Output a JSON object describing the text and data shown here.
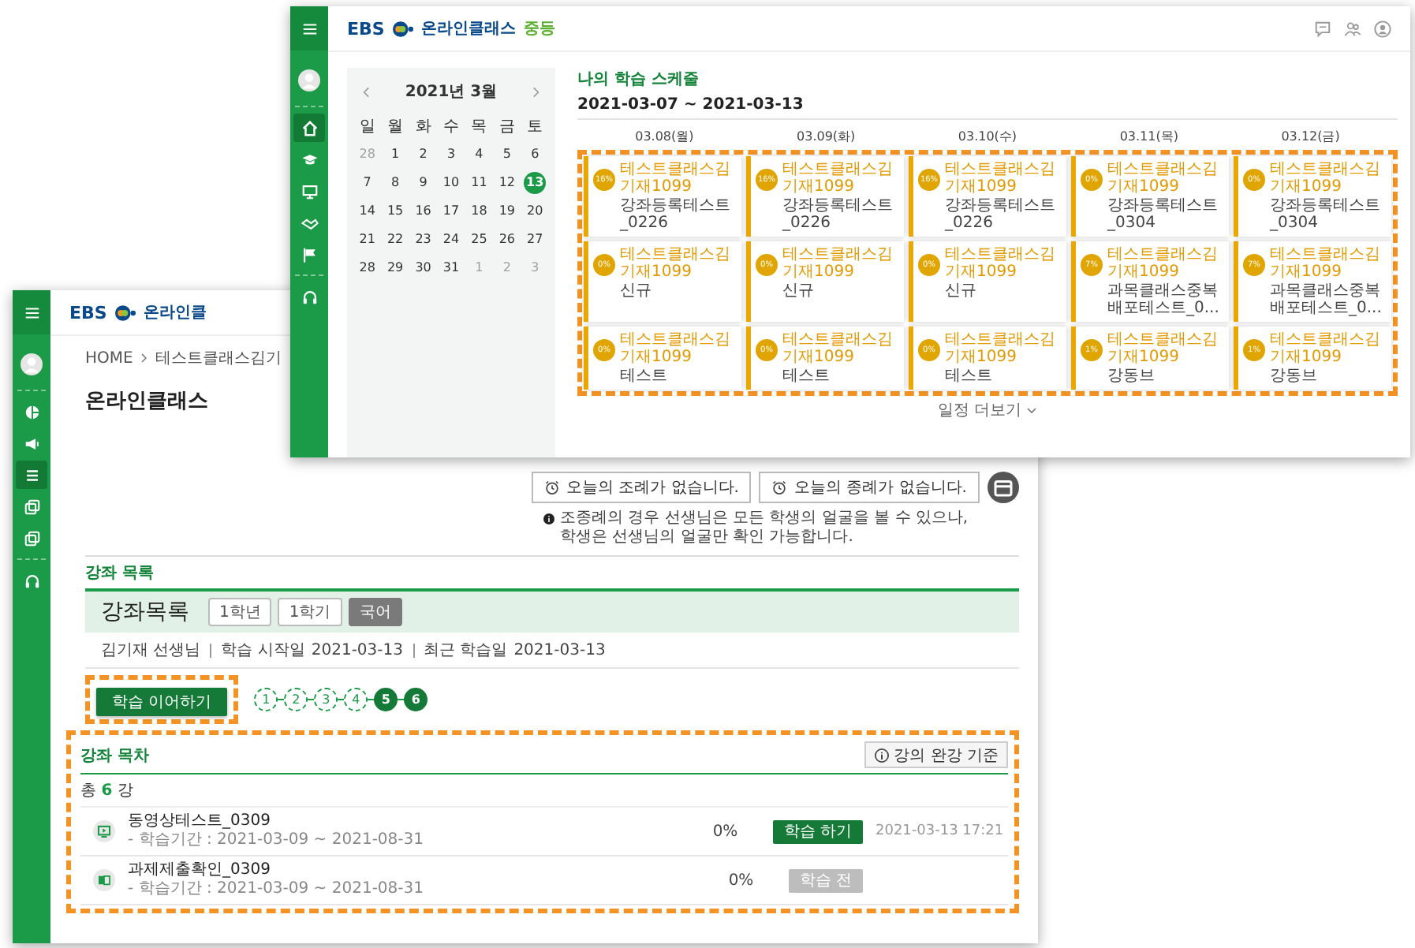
{
  "front": {
    "logo": {
      "brand": "EBS",
      "service": "온라인클"
    },
    "sidebar": [
      {
        "selected": false
      },
      {
        "selected": false
      },
      {
        "selected": true
      },
      {
        "selected": false
      },
      {
        "selected": false
      },
      {
        "selected": false
      }
    ],
    "breadcrumb": [
      "HOME",
      "테스트클래스김기"
    ],
    "page_title": "온라인클래스",
    "notice_buttons": [
      "오늘의 조례가 없습니다.",
      "오늘의 종례가 없습니다."
    ],
    "note": [
      "조종례의 경우 선생님은 모든 학생의 얼굴을 볼 수 있으나,",
      "학생은 선생님의 얼굴만 확인 가능합니다."
    ],
    "section_label": "강좌 목록",
    "course": {
      "title": "강좌목록",
      "chips": [
        {
          "label": "1학년",
          "selected": false
        },
        {
          "label": "1학기",
          "selected": false
        },
        {
          "label": "국어",
          "selected": true
        }
      ],
      "teacher": "김기재 선생님",
      "start_label": "학습 시작일",
      "start_date": "2021-03-13",
      "recent_label": "최근 학습일",
      "recent_date": "2021-03-13"
    },
    "continue_button": "학습 이어하기",
    "continue_highlighted": true,
    "steps": [
      {
        "label": "1",
        "done": false
      },
      {
        "label": "2",
        "done": false
      },
      {
        "label": "3",
        "done": false
      },
      {
        "label": "4",
        "done": false
      },
      {
        "label": "5",
        "done": true
      },
      {
        "label": "6",
        "done": true
      }
    ],
    "lectures": {
      "highlighted": true,
      "title": "강좌 목차",
      "criteria_button": "강의 완강 기준",
      "count": "총 **6** 강",
      "rows": [
        {
          "kind": "video",
          "title": "동영상테스트_0309",
          "period": "- 학습기간 : 2021-03-09 ~ 2021-08-31",
          "progress": "0%",
          "action": "학습 하기",
          "disabled": false,
          "date": "2021-03-13 17:21"
        },
        {
          "kind": "assignment",
          "title": "과제제출확인_0309",
          "period": "- 학습기간 : 2021-03-09 ~ 2021-08-31",
          "progress": "0%",
          "action": "학습 전",
          "disabled": true
        }
      ]
    }
  },
  "back": {
    "logo": {
      "brand": "EBS",
      "service": "온라인클래스",
      "level": "중등"
    },
    "sidebar": [
      {
        "selected": true
      },
      {
        "selected": false
      },
      {
        "selected": false
      },
      {
        "selected": false
      },
      {
        "selected": false
      },
      {
        "selected": false
      }
    ],
    "calendar": {
      "month": "2021년 3월",
      "weekdays": [
        "일",
        "월",
        "화",
        "수",
        "목",
        "금",
        "토"
      ],
      "days": [
        {
          "day": "28",
          "muted": true,
          "selected": false
        },
        {
          "day": "1",
          "muted": false,
          "selected": false
        },
        {
          "day": "2",
          "muted": false,
          "selected": false
        },
        {
          "day": "3",
          "muted": false,
          "selected": false
        },
        {
          "day": "4",
          "muted": false,
          "selected": false
        },
        {
          "day": "5",
          "muted": false,
          "selected": false
        },
        {
          "day": "6",
          "muted": false,
          "selected": false
        },
        {
          "day": "7",
          "muted": false,
          "selected": false
        },
        {
          "day": "8",
          "muted": false,
          "selected": false
        },
        {
          "day": "9",
          "muted": false,
          "selected": false
        },
        {
          "day": "10",
          "muted": false,
          "selected": false
        },
        {
          "day": "11",
          "muted": false,
          "selected": false
        },
        {
          "day": "12",
          "muted": false,
          "selected": false
        },
        {
          "day": "13",
          "muted": false,
          "selected": true
        },
        {
          "day": "14",
          "muted": false,
          "selected": false
        },
        {
          "day": "15",
          "muted": false,
          "selected": false
        },
        {
          "day": "16",
          "muted": false,
          "selected": false
        },
        {
          "day": "17",
          "muted": false,
          "selected": false
        },
        {
          "day": "18",
          "muted": false,
          "selected": false
        },
        {
          "day": "19",
          "muted": false,
          "selected": false
        },
        {
          "day": "20",
          "muted": false,
          "selected": false
        },
        {
          "day": "21",
          "muted": false,
          "selected": false
        },
        {
          "day": "22",
          "muted": false,
          "selected": false
        },
        {
          "day": "23",
          "muted": false,
          "selected": false
        },
        {
          "day": "24",
          "muted": false,
          "selected": false
        },
        {
          "day": "25",
          "muted": false,
          "selected": false
        },
        {
          "day": "26",
          "muted": false,
          "selected": false
        },
        {
          "day": "27",
          "muted": false,
          "selected": false
        },
        {
          "day": "28",
          "muted": false,
          "selected": false
        },
        {
          "day": "29",
          "muted": false,
          "selected": false
        },
        {
          "day": "30",
          "muted": false,
          "selected": false
        },
        {
          "day": "31",
          "muted": false,
          "selected": false
        },
        {
          "day": "1",
          "muted": true,
          "selected": false
        },
        {
          "day": "2",
          "muted": true,
          "selected": false
        },
        {
          "day": "3",
          "muted": true,
          "selected": false
        }
      ]
    },
    "schedule": {
      "title": "나의 학습 스케줄",
      "range": "2021-03-07 ~ 2021-03-13",
      "highlighted": true,
      "more": "일정 더보기",
      "days": [
        {
          "label": "03.08(월)",
          "cards": [
            {
              "percent": "16%",
              "title": "테스트클래스김기재1099",
              "subtitle": "강좌등록테스트_0226"
            },
            {
              "percent": "0%",
              "title": "테스트클래스김기재1099",
              "subtitle": "신규"
            },
            {
              "percent": "0%",
              "title": "테스트클래스김기재1099",
              "subtitle": "테스트"
            }
          ]
        },
        {
          "label": "03.09(화)",
          "cards": [
            {
              "percent": "16%",
              "title": "테스트클래스김기재1099",
              "subtitle": "강좌등록테스트_0226"
            },
            {
              "percent": "0%",
              "title": "테스트클래스김기재1099",
              "subtitle": "신규"
            },
            {
              "percent": "0%",
              "title": "테스트클래스김기재1099",
              "subtitle": "테스트"
            }
          ]
        },
        {
          "label": "03.10(수)",
          "cards": [
            {
              "percent": "16%",
              "title": "테스트클래스김기재1099",
              "subtitle": "강좌등록테스트_0226"
            },
            {
              "percent": "0%",
              "title": "테스트클래스김기재1099",
              "subtitle": "신규"
            },
            {
              "percent": "0%",
              "title": "테스트클래스김기재1099",
              "subtitle": "테스트"
            }
          ]
        },
        {
          "label": "03.11(목)",
          "cards": [
            {
              "percent": "0%",
              "title": "테스트클래스김기재1099",
              "subtitle": "강좌등록테스트_0304"
            },
            {
              "percent": "7%",
              "title": "테스트클래스김기재1099",
              "subtitle": "과목클래스중복배포테스트_0..."
            },
            {
              "percent": "1%",
              "title": "테스트클래스김기재1099",
              "subtitle": "강동브"
            }
          ]
        },
        {
          "label": "03.12(금)",
          "cards": [
            {
              "percent": "0%",
              "title": "테스트클래스김기재1099",
              "subtitle": "강좌등록테스트_0304"
            },
            {
              "percent": "7%",
              "title": "테스트클래스김기재1099",
              "subtitle": "과목클래스중복배포테스트_0..."
            },
            {
              "percent": "1%",
              "title": "테스트클래스김기재1099",
              "subtitle": "강동브"
            }
          ]
        }
      ]
    }
  }
}
